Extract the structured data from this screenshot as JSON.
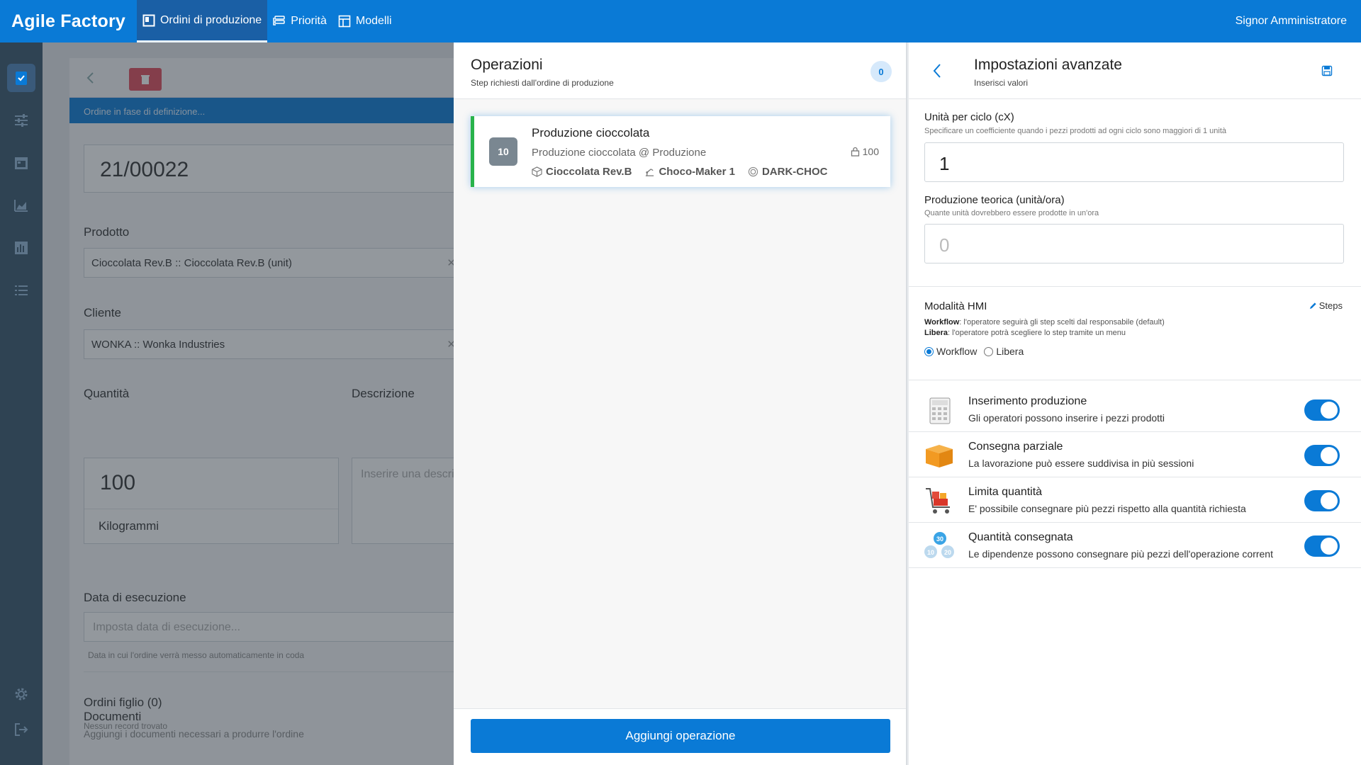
{
  "app": {
    "brand": "Agile Factory",
    "user": "Signor Amministratore"
  },
  "nav": {
    "tabs": [
      {
        "label": "Ordini di produzione",
        "icon": "board-icon",
        "active": true
      },
      {
        "label": "Priorità",
        "icon": "priority-list-icon",
        "active": false
      },
      {
        "label": "Modelli",
        "icon": "template-icon",
        "active": false
      }
    ]
  },
  "sidebar": {
    "items": [
      {
        "icon": "clipboard-check-icon",
        "active": true
      },
      {
        "icon": "sliders-icon",
        "active": false
      },
      {
        "icon": "calendar-icon",
        "active": false
      },
      {
        "icon": "area-chart-icon",
        "active": false
      },
      {
        "icon": "bar-chart-icon",
        "active": false
      },
      {
        "icon": "list-icon",
        "active": false
      },
      {
        "icon": "gear-icon",
        "active": false
      },
      {
        "icon": "logout-icon",
        "active": false
      }
    ]
  },
  "order_form": {
    "status_text": "Ordine in fase di definizione...",
    "code": "21/00022",
    "product_label": "Prodotto",
    "product_value": "Cioccolata Rev.B :: Cioccolata Rev.B (unit)",
    "customer_label": "Cliente",
    "customer_value": "WONKA :: Wonka Industries",
    "quantity_label": "Quantità",
    "quantity_value": "100",
    "unit_value": "Kilogrammi",
    "description_label": "Descrizione",
    "description_placeholder": "Inserire una descrizione",
    "date_label": "Data di esecuzione",
    "date_placeholder": "Imposta data di esecuzione...",
    "date_hint": "Data in cui l'ordine verrà messo automaticamente in coda",
    "children_label": "Ordini figlio (0)",
    "children_empty": "Nessun record trovato",
    "documents_label": "Documenti",
    "documents_hint": "Aggiungi i documenti necessari a produrre l'ordine"
  },
  "operations": {
    "title": "Operazioni",
    "subtitle": "Step richiesti dall'ordine di produzione",
    "badge": "0",
    "items": [
      {
        "step": "10",
        "name": "Produzione cioccolata",
        "location": "Produzione cioccolata @ Produzione",
        "quantity": "100",
        "tags": [
          {
            "icon": "cube-icon",
            "label": "Cioccolata Rev.B"
          },
          {
            "icon": "machine-icon",
            "label": "Choco-Maker 1"
          },
          {
            "icon": "recipe-icon",
            "label": "DARK-CHOC"
          }
        ]
      }
    ],
    "add_button": "Aggiungi operazione"
  },
  "advanced": {
    "title": "Impostazioni avanzate",
    "subtitle": "Inserisci valori",
    "cycle_label": "Unità per ciclo (cX)",
    "cycle_hint": "Specificare un coefficiente quando i pezzi prodotti ad ogni ciclo sono maggiori di 1 unità",
    "cycle_value": "1",
    "theoretical_label": "Produzione teorica (unità/ora)",
    "theoretical_hint": "Quante unità dovrebbero essere prodotte in un'ora",
    "theoretical_placeholder": "0",
    "hmi_title": "Modalità HMI",
    "hmi_steps_link": "Steps",
    "hmi_workflow_key": "Workflow",
    "hmi_workflow_desc": ": l'operatore seguirà gli step scelti dal responsabile (default)",
    "hmi_free_key": "Libera",
    "hmi_free_desc": ": l'operatore potrà scegliere lo step tramite un menu",
    "hmi_options": [
      {
        "label": "Workflow",
        "selected": true
      },
      {
        "label": "Libera",
        "selected": false
      }
    ],
    "features": [
      {
        "icon": "calculator-icon",
        "name": "Inserimento produzione",
        "desc": "Gli operatori possono inserire i pezzi prodotti",
        "enabled": true
      },
      {
        "icon": "box-icon",
        "name": "Consegna parziale",
        "desc": "La lavorazione può essere suddivisa in più sessioni",
        "enabled": true
      },
      {
        "icon": "cart-icon",
        "name": "Limita quantità",
        "desc": "E' possibile consegnare più pezzi rispetto alla quantità richiesta",
        "enabled": true
      },
      {
        "icon": "numbered-balls-icon",
        "name": "Quantità consegnata",
        "desc": "Le dipendenze possono consegnare più pezzi dell'operazione corrent",
        "enabled": true
      }
    ],
    "ball_numbers": [
      "30",
      "10",
      "20"
    ]
  },
  "colors": {
    "primary": "#0a7ad6",
    "sidebar": "#2f4353",
    "success": "#28b34b",
    "danger": "#e04b5a"
  }
}
